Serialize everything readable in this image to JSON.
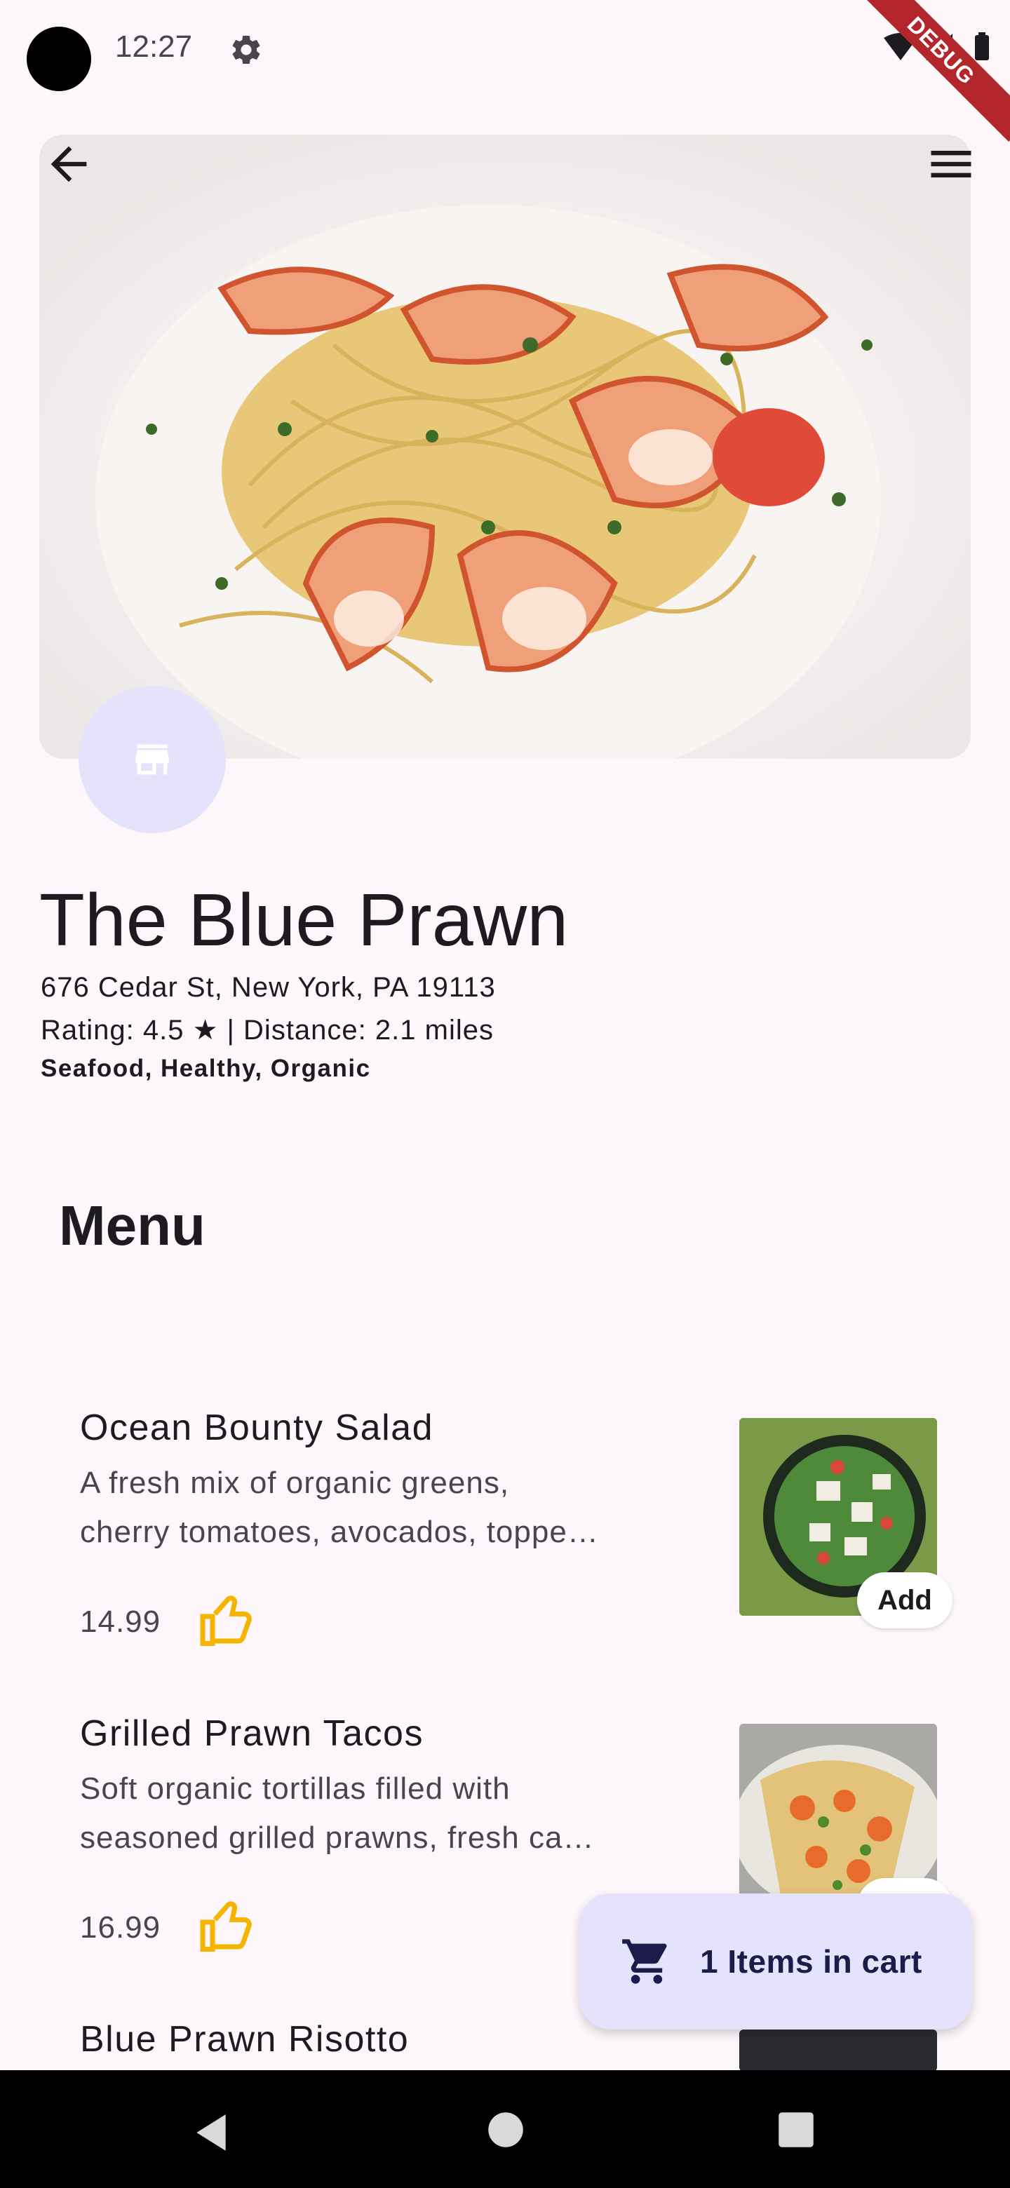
{
  "status_bar": {
    "time": "12:27",
    "debug_label": "DEBUG",
    "icons": [
      "settings-icon",
      "wifi-icon",
      "signal-icon",
      "battery-icon"
    ]
  },
  "header": {
    "back_icon": "arrow-back-icon",
    "menu_icon": "hamburger-menu-icon",
    "store_icon": "storefront-icon"
  },
  "restaurant": {
    "name": "The Blue Prawn",
    "address": "676 Cedar St, New York, PA 19113",
    "rating_line": "Rating: 4.5 ★ | Distance: 2.1 miles",
    "tags": "Seafood, Healthy, Organic"
  },
  "menu": {
    "heading": "Menu",
    "items": [
      {
        "name": "Ocean Bounty Salad",
        "desc_line1": "A fresh mix of organic greens,",
        "desc_line2": "cherry tomatoes, avocados, toppe…",
        "price": "14.99",
        "add_label": "Add"
      },
      {
        "name": "Grilled Prawn Tacos",
        "desc_line1": "Soft organic tortillas filled with",
        "desc_line2": "seasoned grilled prawns, fresh ca…",
        "price": "16.99",
        "add_label": "Add"
      },
      {
        "name": "Blue Prawn Risotto"
      }
    ]
  },
  "cart": {
    "label": "1 Items in cart",
    "icon": "shopping-cart-icon"
  },
  "colors": {
    "background": "#fdf7fc",
    "accent_container": "#e4e3fb",
    "thumb_up": "#f5b400",
    "debug_ribbon": "#b3262c"
  }
}
